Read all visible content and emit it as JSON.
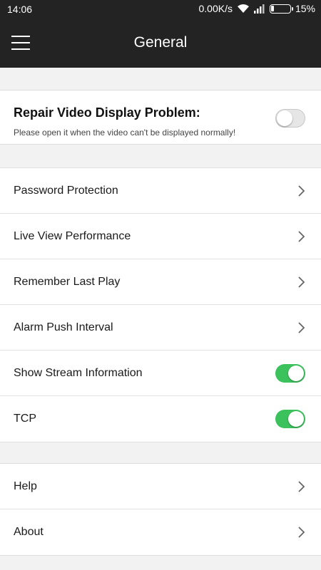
{
  "status_bar": {
    "time": "14:06",
    "network_speed": "0.00K/s",
    "battery_percent": "15%",
    "battery_level": 0.15,
    "icons": [
      "wifi-icon",
      "signal-icon",
      "battery-icon"
    ]
  },
  "app_bar": {
    "title": "General",
    "menu_icon": "hamburger-menu-icon"
  },
  "repair": {
    "title": "Repair Video Display Problem:",
    "description": "Please open it when the video can't be displayed normally!",
    "enabled": false
  },
  "settings": {
    "password_protection": "Password Protection",
    "live_view_performance": "Live View Performance",
    "remember_last_play": "Remember Last Play",
    "alarm_push_interval": "Alarm Push Interval",
    "show_stream_information": "Show Stream Information",
    "show_stream_information_enabled": true,
    "tcp": "TCP",
    "tcp_enabled": true
  },
  "more": {
    "help": "Help",
    "about": "About"
  },
  "colors": {
    "toolbar": "#232323",
    "toggle_on": "#3cc25c",
    "background": "#f2f2f2"
  }
}
